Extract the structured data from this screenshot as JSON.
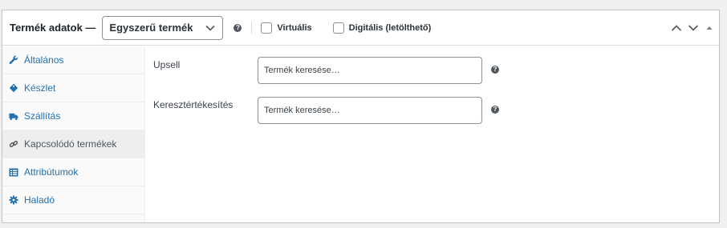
{
  "header": {
    "title": "Termék adatok —",
    "product_type": "Egyszerű termék",
    "help": "?",
    "virtual_label": "Virtuális",
    "downloadable_label": "Digitális (letölthető)"
  },
  "sidebar": {
    "items": [
      {
        "label": "Általános",
        "icon": "wrench-icon",
        "active": false
      },
      {
        "label": "Készlet",
        "icon": "tag-icon",
        "active": false
      },
      {
        "label": "Szállítás",
        "icon": "truck-icon",
        "active": false
      },
      {
        "label": "Kapcsolódó termékek",
        "icon": "link-icon",
        "active": true
      },
      {
        "label": "Attribútumok",
        "icon": "list-icon",
        "active": false
      },
      {
        "label": "Haladó",
        "icon": "gear-icon",
        "active": false
      }
    ]
  },
  "linked": {
    "upsell_label": "Upsell",
    "upsell_placeholder": "Termék keresése…",
    "crosssell_label": "Keresztértékesítés",
    "crosssell_placeholder": "Termék keresése…"
  },
  "colors": {
    "link": "#2271b1",
    "border": "#c3c4c7",
    "active_tab_bg": "#eeeeee"
  }
}
